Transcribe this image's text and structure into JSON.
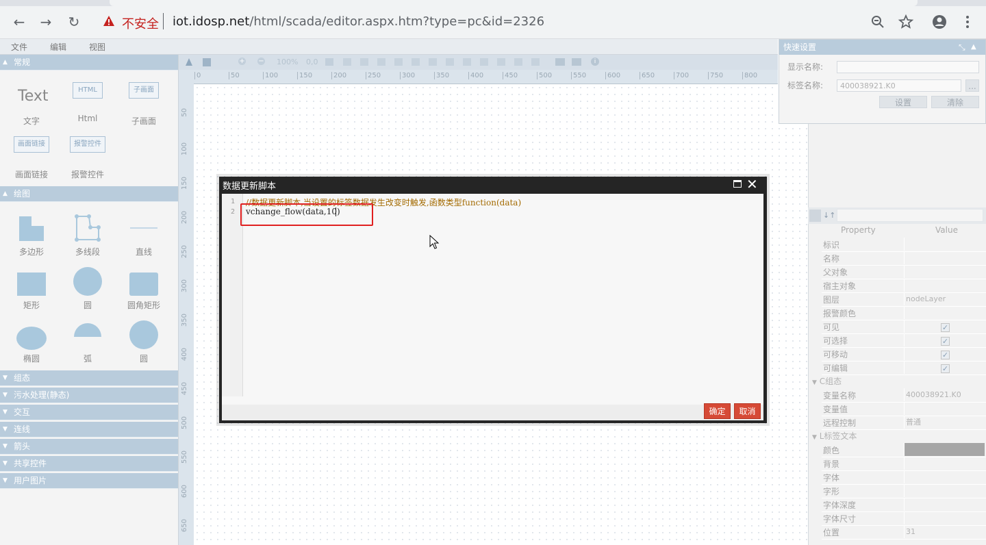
{
  "browser": {
    "insecure_label": "不安全",
    "url_host": "iot.idosp.net",
    "url_path": "/html/scada/editor.aspx.htm?type=pc&id=2326"
  },
  "menubar": {
    "items": [
      "文件",
      "编辑",
      "视图"
    ]
  },
  "palette": {
    "sections": [
      {
        "label": "常规",
        "expanded": true
      },
      {
        "label": "绘图",
        "expanded": true
      },
      {
        "label": "组态",
        "expanded": false
      },
      {
        "label": "污水处理(静态)",
        "expanded": false
      },
      {
        "label": "交互",
        "expanded": false
      },
      {
        "label": "连线",
        "expanded": false
      },
      {
        "label": "箭头",
        "expanded": false
      },
      {
        "label": "共享控件",
        "expanded": false
      },
      {
        "label": "用户图片",
        "expanded": false
      }
    ],
    "general_items": [
      {
        "icon_text": "Text",
        "label": "文字"
      },
      {
        "icon_text": "HTML",
        "label": "Html"
      },
      {
        "icon_text": "子画面",
        "label": "子画面"
      },
      {
        "icon_text": "画面链接",
        "label": "画面链接"
      },
      {
        "icon_text": "报警控件",
        "label": "报警控件"
      }
    ],
    "draw_items": [
      {
        "label": "多边形"
      },
      {
        "label": "多线段"
      },
      {
        "label": "直线"
      },
      {
        "label": "矩形"
      },
      {
        "label": "圆"
      },
      {
        "label": "圆角矩形"
      },
      {
        "label": "椭圆"
      },
      {
        "label": "弧"
      },
      {
        "label": "圆"
      }
    ]
  },
  "toolbar": {
    "zoom": "100%",
    "offset": "0,0"
  },
  "ruler": {
    "top_ticks": [
      "0",
      "50",
      "100",
      "150",
      "200",
      "250",
      "300",
      "350",
      "400",
      "450",
      "500",
      "550",
      "600",
      "650",
      "700",
      "750",
      "800"
    ],
    "left_ticks": [
      "50",
      "100",
      "150",
      "200",
      "250",
      "300",
      "350",
      "400",
      "450",
      "500",
      "550",
      "600",
      "650"
    ]
  },
  "quick_settings": {
    "title": "快速设置",
    "display_name_label": "显示名称:",
    "display_name_value": "",
    "tag_name_label": "标签名称:",
    "tag_name_value": "400038921.K0",
    "browse_label": "...",
    "set_button": "设置",
    "clear_button": "清除"
  },
  "properties": {
    "col_property": "Property",
    "col_value": "Value",
    "rows": [
      {
        "name": "标识",
        "value": ""
      },
      {
        "name": "名称",
        "value": ""
      },
      {
        "name": "父对象",
        "value": ""
      },
      {
        "name": "宿主对象",
        "value": ""
      },
      {
        "name": "图层",
        "value": "nodeLayer"
      },
      {
        "name": "报警颜色",
        "value": ""
      },
      {
        "name": "可见",
        "checked": true
      },
      {
        "name": "可选择",
        "checked": true
      },
      {
        "name": "可移动",
        "checked": true
      },
      {
        "name": "可编辑",
        "checked": true
      }
    ],
    "group_c": "C组态",
    "rows_c": [
      {
        "name": "变量名称",
        "value": "400038921.K0"
      },
      {
        "name": "变量值",
        "value": ""
      },
      {
        "name": "远程控制",
        "value": "普通"
      }
    ],
    "group_l": "L标签文本",
    "rows_l": [
      {
        "name": "颜色",
        "value": "",
        "swatch": "#a6a6a6"
      },
      {
        "name": "背景",
        "value": ""
      },
      {
        "name": "字体",
        "value": ""
      },
      {
        "name": "字形",
        "value": ""
      },
      {
        "name": "字体深度",
        "value": ""
      },
      {
        "name": "字体尺寸",
        "value": ""
      },
      {
        "name": "位置",
        "value": "31"
      }
    ]
  },
  "dialog": {
    "title": "数据更新脚本",
    "lines": [
      {
        "no": "1",
        "text": "//数据更新脚本,当设置的标签数据发生改变时触发,函数类型function(data)"
      },
      {
        "no": "2",
        "text": "vchange_flow(data,10)"
      }
    ],
    "ok_button": "确定",
    "cancel_button": "取消"
  },
  "colors": {
    "accent": "#b9ccdc",
    "danger_button": "#d64a36",
    "highlight_box": "#e02020"
  }
}
